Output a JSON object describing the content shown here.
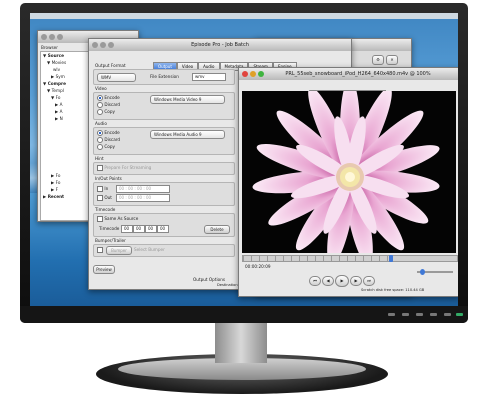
{
  "browser_window": {
    "title": "Browser",
    "tree": [
      "Source",
      "Movies",
      "wlv",
      "Sym",
      "Compre",
      "Templ",
      "Fo",
      "A",
      "A",
      "N",
      "Fo",
      "Fo",
      "F",
      "Recent"
    ]
  },
  "job_batch_window": {
    "title": "Episode Pro - Job Batch",
    "tabs": [
      "Output",
      "Video",
      "Audio",
      "Metadata",
      "Stream",
      "Engine"
    ],
    "selected_tab": "Output",
    "output_format_label": "Output Format",
    "output_format_value": "WMV",
    "file_extension_label": "File Extension",
    "file_extension_value": "wmv",
    "video_label": "Video",
    "video_options": [
      "Encode",
      "Discard",
      "Copy"
    ],
    "video_codec": "Windows Media Video 9",
    "audio_label": "Audio",
    "audio_options": [
      "Encode",
      "Discard",
      "Copy"
    ],
    "audio_codec": "Windows Media Audio 9",
    "hint_label": "Hint",
    "hint_option": "Prepare For Streaming",
    "inout_label": "In/Out Points",
    "in_label": "In",
    "out_label": "Out",
    "timecode_label": "Timecode",
    "same_as_source": "Same As Source",
    "timecode_field_label": "Timecode",
    "timecode_values": [
      "00",
      "00",
      "00",
      "00"
    ],
    "delete_label": "Delete",
    "bumper_label": "Bumper/Trailer",
    "bumper_btn": "Bumper",
    "select_bumper": "Select Bumper",
    "preview_btn": "Preview",
    "output_options_label": "Output Options",
    "destination_label": "Destination Folder:"
  },
  "preview_window": {
    "title": "PRL_55seb_snowboard_iPod_H264_640x480.m4v @ 100%",
    "tabs": [
      "Source",
      "Preview",
      "Encoded"
    ],
    "selected_tab": "Encoded",
    "timecode": "00:00:20:09",
    "status": "Scratch disk free space: 110.44 GB"
  },
  "colors": {
    "accent_blue": "#3f78d6",
    "desktop_sky": "#5aa0d8",
    "flower_pink": "#e9a6d2"
  }
}
